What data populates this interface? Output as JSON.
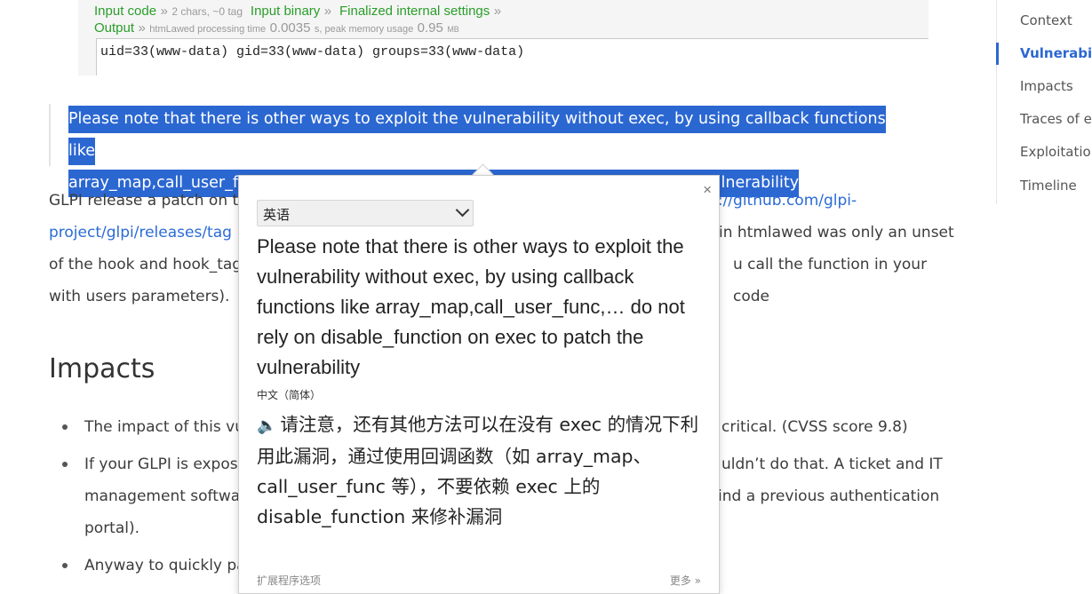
{
  "demo": {
    "line1": {
      "input_code": "Input code",
      "arrow": "»",
      "input_stats": "2 chars, ~0 tag",
      "input_binary": "Input binary",
      "finalized": "Finalized internal settings"
    },
    "line2": {
      "output": "Output",
      "arrow": "»",
      "proc_prefix": "htmLawed processing time",
      "proc_time": "0.0035",
      "proc_mid": "s, peak memory usage",
      "mem": "0.95",
      "mem_unit": "MB"
    },
    "output_text": "uid=33(www-data) gid=33(www-data) groups=33(www-data)"
  },
  "quote": {
    "line1": "Please note that there is other ways to exploit the vulnerability without exec, by using callback functions like",
    "line2": "array_map,call_user_func,… do not rely on disable_function on exec to patch the vulnerability"
  },
  "paragraph": {
    "l1_text": "GLPI release a patch on th",
    "l1_link": "s://github.com/glpi-",
    "l2_link": "project/glpi/releases/tag",
    "l2_text": "in htmlawed was only an unset",
    "l3_a": "of the hook and hook_tag",
    "l3_b": "u call the function in your code",
    "l4": "with users parameters)."
  },
  "impacts": {
    "heading": "Impacts",
    "bullets": [
      {
        "a": "The impact of this vu",
        "b": "critical. (CVSS score 9.8)"
      },
      {
        "a": "If your GLPI is expose",
        "b": "uldn’t do that. A ticket and IT"
      },
      {
        "a": "management softwa",
        "b": "ind a previous authentication"
      },
      {
        "a": "portal).",
        "b": ""
      },
      {
        "a": "Anyway to quickly pa",
        "b": ""
      }
    ]
  },
  "toc": {
    "items": [
      "Context",
      "Vulnerabilit",
      "Impacts",
      "Traces of ex",
      "Exploitation",
      "Timeline"
    ],
    "active_index": 1
  },
  "popup": {
    "close": "×",
    "source_language": "英语",
    "source_text": "Please note that there is other ways to exploit the vulnerability without exec, by using callback functions like array_map,call_user_func,… do not rely on disable_function on exec to patch the vulnerability",
    "target_language": "中文（简体）",
    "speaker_icon": "🔈",
    "translated_text": "请注意，还有其他方法可以在没有 exec 的情况下利用此漏洞，通过使用回调函数（如 array_map、call_user_func 等），不要依赖 exec 上的 disable_function 来修补漏洞",
    "footer_left": "扩展程序选项",
    "footer_right": "更多 »"
  },
  "colors": {
    "highlight": "#2b67d1",
    "link": "#2a6bd6",
    "demo_green": "#2a9d2a"
  }
}
